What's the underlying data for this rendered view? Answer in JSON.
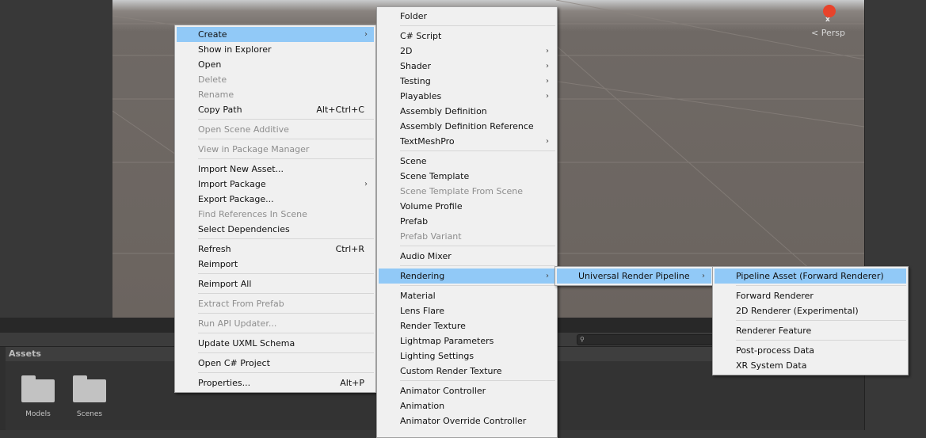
{
  "colors": {
    "highlight": "#91c9f7",
    "menu_bg": "#f0f0f0",
    "disabled": "#8d8d8d",
    "gizmo_x": "#e8432b"
  },
  "scene": {
    "gizmo_axis": "x",
    "projection": "Persp"
  },
  "project": {
    "panel_title": "Assets",
    "search_icon": "search-icon",
    "folders": [
      {
        "name": "Models",
        "icon": "folder-icon"
      },
      {
        "name": "Scenes",
        "icon": "folder-icon"
      }
    ]
  },
  "menus": [
    {
      "id": "context-menu",
      "items": [
        {
          "label": "Create",
          "submenu": true,
          "highlighted": true
        },
        {
          "label": "Show in Explorer"
        },
        {
          "label": "Open"
        },
        {
          "label": "Delete",
          "disabled": true
        },
        {
          "label": "Rename",
          "disabled": true
        },
        {
          "label": "Copy Path",
          "shortcut": "Alt+Ctrl+C"
        },
        {
          "separator": true
        },
        {
          "label": "Open Scene Additive",
          "disabled": true
        },
        {
          "separator": true
        },
        {
          "label": "View in Package Manager",
          "disabled": true
        },
        {
          "separator": true
        },
        {
          "label": "Import New Asset..."
        },
        {
          "label": "Import Package",
          "submenu": true
        },
        {
          "label": "Export Package..."
        },
        {
          "label": "Find References In Scene",
          "disabled": true
        },
        {
          "label": "Select Dependencies"
        },
        {
          "separator": true
        },
        {
          "label": "Refresh",
          "shortcut": "Ctrl+R"
        },
        {
          "label": "Reimport"
        },
        {
          "separator": true
        },
        {
          "label": "Reimport All"
        },
        {
          "separator": true
        },
        {
          "label": "Extract From Prefab",
          "disabled": true
        },
        {
          "separator": true
        },
        {
          "label": "Run API Updater...",
          "disabled": true
        },
        {
          "separator": true
        },
        {
          "label": "Update UXML Schema"
        },
        {
          "separator": true
        },
        {
          "label": "Open C# Project"
        },
        {
          "separator": true
        },
        {
          "label": "Properties...",
          "shortcut": "Alt+P"
        }
      ]
    },
    {
      "id": "create-submenu",
      "items": [
        {
          "label": "Folder"
        },
        {
          "separator": true
        },
        {
          "label": "C# Script"
        },
        {
          "label": "2D",
          "submenu": true
        },
        {
          "label": "Shader",
          "submenu": true
        },
        {
          "label": "Testing",
          "submenu": true
        },
        {
          "label": "Playables",
          "submenu": true
        },
        {
          "label": "Assembly Definition"
        },
        {
          "label": "Assembly Definition Reference"
        },
        {
          "label": "TextMeshPro",
          "submenu": true
        },
        {
          "separator": true
        },
        {
          "label": "Scene"
        },
        {
          "label": "Scene Template"
        },
        {
          "label": "Scene Template From Scene",
          "disabled": true
        },
        {
          "label": "Volume Profile"
        },
        {
          "label": "Prefab"
        },
        {
          "label": "Prefab Variant",
          "disabled": true
        },
        {
          "separator": true
        },
        {
          "label": "Audio Mixer"
        },
        {
          "separator": true
        },
        {
          "label": "Rendering",
          "submenu": true,
          "highlighted": true
        },
        {
          "separator": true
        },
        {
          "label": "Material"
        },
        {
          "label": "Lens Flare"
        },
        {
          "label": "Render Texture"
        },
        {
          "label": "Lightmap Parameters"
        },
        {
          "label": "Lighting Settings"
        },
        {
          "label": "Custom Render Texture"
        },
        {
          "separator": true
        },
        {
          "label": "Animator Controller"
        },
        {
          "label": "Animation"
        },
        {
          "label": "Animator Override Controller"
        }
      ]
    },
    {
      "id": "rendering-submenu",
      "items": [
        {
          "label": "Universal Render Pipeline",
          "submenu": true,
          "highlighted": true
        }
      ]
    },
    {
      "id": "urp-submenu",
      "items": [
        {
          "label": "Pipeline Asset (Forward Renderer)",
          "highlighted": true
        },
        {
          "separator": true
        },
        {
          "label": "Forward Renderer"
        },
        {
          "label": "2D Renderer (Experimental)"
        },
        {
          "separator": true
        },
        {
          "label": "Renderer Feature"
        },
        {
          "separator": true
        },
        {
          "label": "Post-process Data"
        },
        {
          "label": "XR System Data"
        }
      ]
    }
  ]
}
